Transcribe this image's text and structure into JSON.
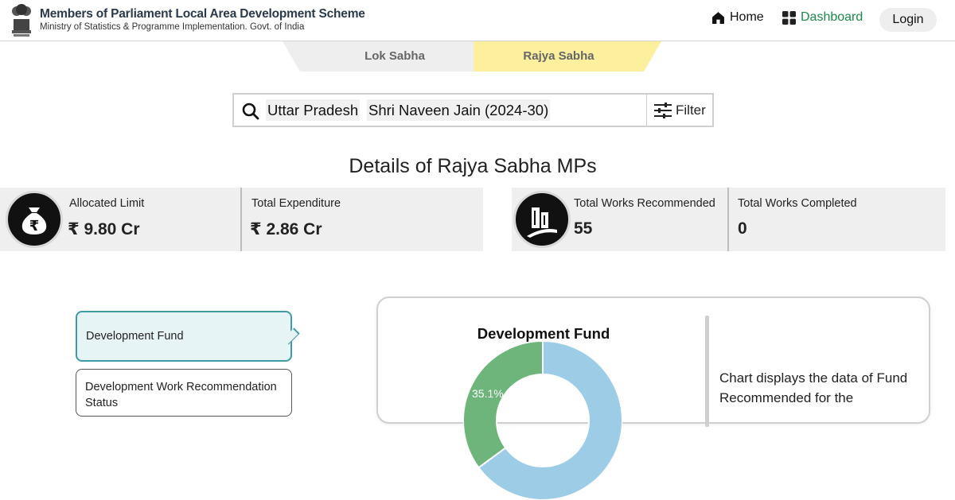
{
  "header": {
    "title": "Members of Parliament Local Area Development Scheme",
    "subtitle": "Ministry of Statistics & Programme Implementation. Govt. of India",
    "nav": {
      "home_label": "Home",
      "home_icon": "home-icon",
      "dashboard_label": "Dashboard",
      "dashboard_icon": "grid-icon",
      "login_label": "Login"
    },
    "colors": {
      "dashboard": "#1a8a4a"
    }
  },
  "tabs": [
    {
      "label": "Lok Sabha",
      "active": false
    },
    {
      "label": "Rajya Sabha",
      "active": true,
      "color": "#fcef9e"
    }
  ],
  "search": {
    "state": "Uttar Pradesh",
    "mp": "Shri Naveen Jain (2024-30)",
    "filter_label": "Filter"
  },
  "section_title": "Details of Rajya Sabha MPs",
  "stats": {
    "allocated": {
      "label": "Allocated Limit",
      "value": "₹ 9.80 Cr"
    },
    "expenditure": {
      "label": "Total Expenditure",
      "value": "₹ 2.86 Cr"
    },
    "recommended": {
      "label": "Total Works Recommended",
      "value": "55"
    },
    "completed": {
      "label": "Total Works Completed",
      "value": "0"
    }
  },
  "menu": [
    {
      "label": "Development Fund",
      "active": true
    },
    {
      "label": "Development Work Recommendation Status",
      "active": false
    }
  ],
  "chart": {
    "title": "Development Fund",
    "description": "Chart displays the data of Fund Recommended for the",
    "colors": {
      "green": "#6db57a",
      "blue": "#9dcde6"
    }
  },
  "chart_data": {
    "type": "pie",
    "title": "Development Fund",
    "slices": [
      {
        "label": "35.1%",
        "value": 35.1,
        "color": "#6db57a"
      },
      {
        "label": "",
        "value": 64.9,
        "color": "#9dcde6"
      }
    ]
  }
}
